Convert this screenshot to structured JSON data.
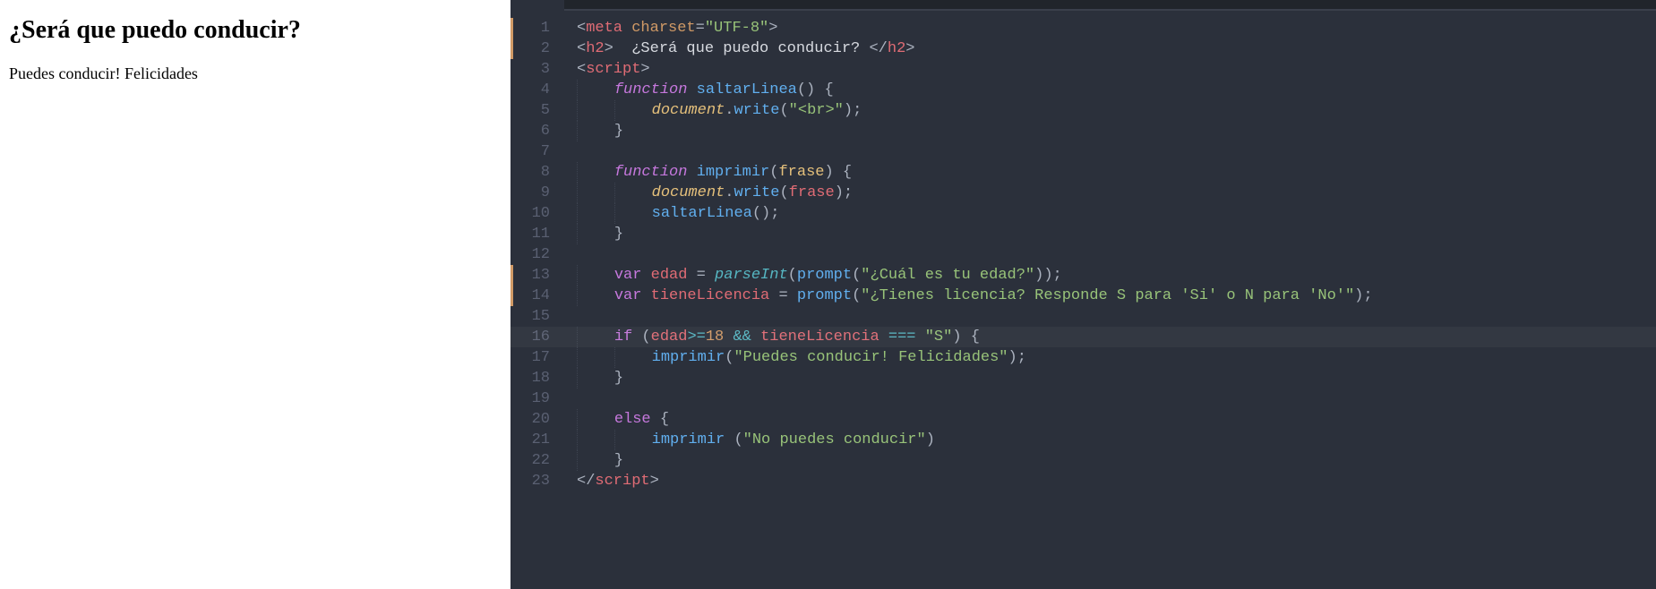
{
  "preview": {
    "heading": "¿Será que puedo conducir?",
    "body": "Puedes conducir! Felicidades"
  },
  "editor": {
    "current_line": 16,
    "modified_lines": [
      1,
      2,
      13,
      14
    ],
    "lines": [
      {
        "n": 1,
        "tokens": [
          [
            "c-punc",
            "<"
          ],
          [
            "c-tag",
            "meta"
          ],
          [
            "c-text",
            " "
          ],
          [
            "c-attr",
            "charset"
          ],
          [
            "c-punc",
            "="
          ],
          [
            "c-str",
            "\"UTF-8\""
          ],
          [
            "c-punc",
            ">"
          ]
        ]
      },
      {
        "n": 2,
        "tokens": [
          [
            "c-punc",
            "<"
          ],
          [
            "c-tag",
            "h2"
          ],
          [
            "c-punc",
            ">"
          ],
          [
            "c-text",
            "  ¿Será que puedo conducir? "
          ],
          [
            "c-punc",
            "</"
          ],
          [
            "c-tag",
            "h2"
          ],
          [
            "c-punc",
            ">"
          ]
        ]
      },
      {
        "n": 3,
        "tokens": [
          [
            "c-punc",
            "<"
          ],
          [
            "c-tag",
            "script"
          ],
          [
            "c-punc",
            ">"
          ]
        ]
      },
      {
        "n": 4,
        "indent": 1,
        "tokens": [
          [
            "c-kw",
            "function"
          ],
          [
            "c-text",
            " "
          ],
          [
            "c-fnname",
            "saltarLinea"
          ],
          [
            "c-punc",
            "() {"
          ]
        ]
      },
      {
        "n": 5,
        "indent": 2,
        "tokens": [
          [
            "c-prop",
            "document"
          ],
          [
            "c-punc",
            "."
          ],
          [
            "c-call",
            "write"
          ],
          [
            "c-punc",
            "("
          ],
          [
            "c-str",
            "\"<br>\""
          ],
          [
            "c-punc",
            ");"
          ]
        ]
      },
      {
        "n": 6,
        "indent": 1,
        "tokens": [
          [
            "c-punc",
            "}"
          ]
        ]
      },
      {
        "n": 7,
        "indent": 0,
        "tokens": []
      },
      {
        "n": 8,
        "indent": 1,
        "tokens": [
          [
            "c-kw",
            "function"
          ],
          [
            "c-text",
            " "
          ],
          [
            "c-fnname",
            "imprimir"
          ],
          [
            "c-punc",
            "("
          ],
          [
            "c-param",
            "frase"
          ],
          [
            "c-punc",
            ") {"
          ]
        ]
      },
      {
        "n": 9,
        "indent": 2,
        "tokens": [
          [
            "c-prop",
            "document"
          ],
          [
            "c-punc",
            "."
          ],
          [
            "c-call",
            "write"
          ],
          [
            "c-punc",
            "("
          ],
          [
            "c-var",
            "frase"
          ],
          [
            "c-punc",
            ");"
          ]
        ]
      },
      {
        "n": 10,
        "indent": 2,
        "tokens": [
          [
            "c-call",
            "saltarLinea"
          ],
          [
            "c-punc",
            "();"
          ]
        ]
      },
      {
        "n": 11,
        "indent": 1,
        "tokens": [
          [
            "c-punc",
            "}"
          ]
        ]
      },
      {
        "n": 12,
        "indent": 0,
        "tokens": []
      },
      {
        "n": 13,
        "indent": 1,
        "tokens": [
          [
            "c-kw2",
            "var"
          ],
          [
            "c-text",
            " "
          ],
          [
            "c-var",
            "edad"
          ],
          [
            "c-text",
            " "
          ],
          [
            "c-punc",
            "="
          ],
          [
            "c-text",
            " "
          ],
          [
            "c-builtin",
            "parseInt"
          ],
          [
            "c-punc",
            "("
          ],
          [
            "c-call",
            "prompt"
          ],
          [
            "c-punc",
            "("
          ],
          [
            "c-str",
            "\"¿Cuál es tu edad?\""
          ],
          [
            "c-punc",
            "));"
          ]
        ]
      },
      {
        "n": 14,
        "indent": 1,
        "tokens": [
          [
            "c-kw2",
            "var"
          ],
          [
            "c-text",
            " "
          ],
          [
            "c-var",
            "tieneLicencia"
          ],
          [
            "c-text",
            " "
          ],
          [
            "c-punc",
            "="
          ],
          [
            "c-text",
            " "
          ],
          [
            "c-call",
            "prompt"
          ],
          [
            "c-punc",
            "("
          ],
          [
            "c-str",
            "\"¿Tienes licencia? Responde S para 'Si' o N para 'No'\""
          ],
          [
            "c-punc",
            ");"
          ]
        ]
      },
      {
        "n": 15,
        "indent": 0,
        "tokens": []
      },
      {
        "n": 16,
        "indent": 1,
        "tokens": [
          [
            "c-kw2",
            "if"
          ],
          [
            "c-text",
            " "
          ],
          [
            "c-punc",
            "("
          ],
          [
            "c-var",
            "edad"
          ],
          [
            "c-op",
            ">="
          ],
          [
            "c-num",
            "18"
          ],
          [
            "c-text",
            " "
          ],
          [
            "c-op",
            "&&"
          ],
          [
            "c-text",
            " "
          ],
          [
            "c-var",
            "tieneLicencia"
          ],
          [
            "c-text",
            " "
          ],
          [
            "c-op",
            "==="
          ],
          [
            "c-text",
            " "
          ],
          [
            "c-str",
            "\"S\""
          ],
          [
            "c-punc",
            ") {"
          ]
        ]
      },
      {
        "n": 17,
        "indent": 2,
        "tokens": [
          [
            "c-call",
            "imprimir"
          ],
          [
            "c-punc",
            "("
          ],
          [
            "c-str",
            "\"Puedes conducir! Felicidades\""
          ],
          [
            "c-punc",
            ");"
          ]
        ]
      },
      {
        "n": 18,
        "indent": 1,
        "tokens": [
          [
            "c-punc",
            "}"
          ]
        ]
      },
      {
        "n": 19,
        "indent": 0,
        "tokens": []
      },
      {
        "n": 20,
        "indent": 1,
        "tokens": [
          [
            "c-kw2",
            "else"
          ],
          [
            "c-text",
            " "
          ],
          [
            "c-punc",
            "{"
          ]
        ]
      },
      {
        "n": 21,
        "indent": 2,
        "tokens": [
          [
            "c-call",
            "imprimir"
          ],
          [
            "c-text",
            " "
          ],
          [
            "c-punc",
            "("
          ],
          [
            "c-str",
            "\"No puedes conducir\""
          ],
          [
            "c-punc",
            ")"
          ]
        ]
      },
      {
        "n": 22,
        "indent": 1,
        "tokens": [
          [
            "c-punc",
            "}"
          ]
        ]
      },
      {
        "n": 23,
        "tokens": [
          [
            "c-punc",
            "</"
          ],
          [
            "c-tag",
            "script"
          ],
          [
            "c-punc",
            ">"
          ]
        ]
      }
    ]
  }
}
